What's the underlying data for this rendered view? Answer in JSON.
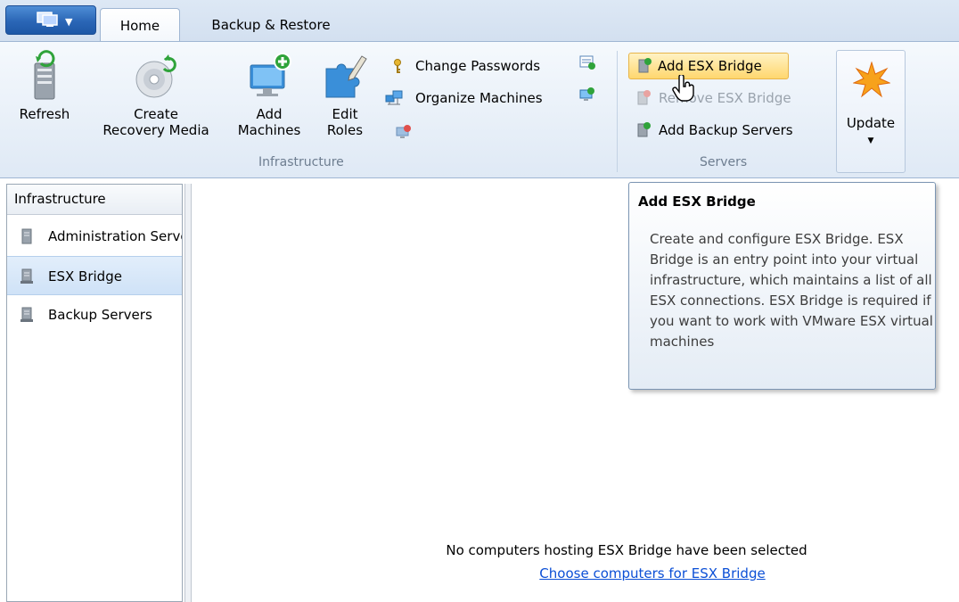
{
  "tabs": {
    "home": "Home",
    "backup_restore": "Backup & Restore"
  },
  "ribbon": {
    "refresh": "Refresh",
    "create_recovery_line1": "Create",
    "create_recovery_line2": "Recovery Media",
    "add_machines_line1": "Add",
    "add_machines_line2": "Machines",
    "edit_roles_line1": "Edit",
    "edit_roles_line2": "Roles",
    "change_passwords": "Change Passwords",
    "organize_machines": "Organize Machines",
    "infrastructure_group": "Infrastructure",
    "add_esx_bridge": "Add ESX Bridge",
    "remove_esx_bridge": "Remove ESX Bridge",
    "add_backup_servers": "Add Backup Servers",
    "servers_group": "Servers",
    "update": "Update"
  },
  "left_pane": {
    "header": "Infrastructure",
    "items": [
      {
        "label": "Administration Servers",
        "selected": false
      },
      {
        "label": "ESX Bridge",
        "selected": true
      },
      {
        "label": "Backup Servers",
        "selected": false
      }
    ]
  },
  "main": {
    "empty_message": "No computers hosting ESX Bridge have been selected",
    "empty_link": "Choose computers for ESX Bridge"
  },
  "tooltip": {
    "title": "Add ESX Bridge",
    "body": "Create and configure ESX Bridge. ESX Bridge is an entry point into your virtual infrastructure, which maintains a list of all ESX connections. ESX Bridge is required if you want to work with VMware ESX virtual machines"
  },
  "colors": {
    "accent": "#2a66b6",
    "link": "#0b4fd6",
    "hover": "#ffd76e"
  }
}
